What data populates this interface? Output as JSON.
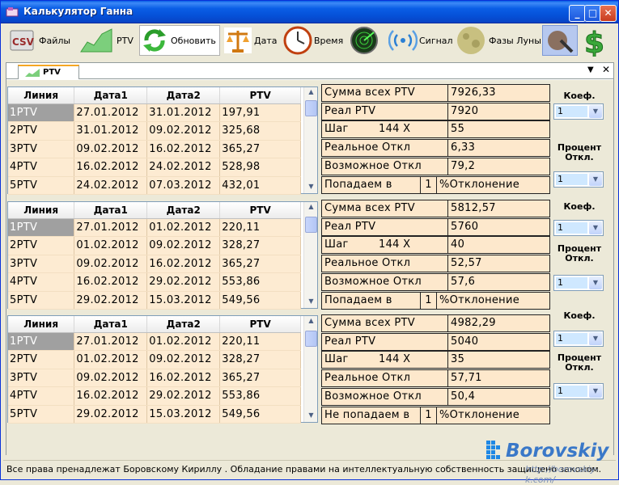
{
  "window": {
    "title": "Калькулятор Ганна"
  },
  "toolbar": {
    "files": "Файлы",
    "ptv": "PTV",
    "refresh": "Обновить",
    "date": "Дата",
    "time": "Время",
    "signal": "Сигнал",
    "moon": "Фазы Луны",
    "csv_text": "CSV",
    "dollar_text": "$"
  },
  "tab": {
    "label": "PTV"
  },
  "columns": [
    "Линия",
    "Дата1",
    "Дата2",
    "PTV"
  ],
  "grids": [
    {
      "rows": [
        [
          "1PTV",
          "27.01.2012",
          "31.01.2012",
          "197,91"
        ],
        [
          "2PTV",
          "31.01.2012",
          "09.02.2012",
          "325,68"
        ],
        [
          "3PTV",
          "09.02.2012",
          "16.02.2012",
          "365,27"
        ],
        [
          "4PTV",
          "16.02.2012",
          "24.02.2012",
          "528,98"
        ],
        [
          "5PTV",
          "24.02.2012",
          "07.03.2012",
          "432,01"
        ]
      ]
    },
    {
      "rows": [
        [
          "1PTV",
          "27.01.2012",
          "01.02.2012",
          "220,11"
        ],
        [
          "2PTV",
          "01.02.2012",
          "09.02.2012",
          "328,27"
        ],
        [
          "3PTV",
          "09.02.2012",
          "16.02.2012",
          "365,27"
        ],
        [
          "4PTV",
          "16.02.2012",
          "29.02.2012",
          "553,86"
        ],
        [
          "5PTV",
          "29.02.2012",
          "15.03.2012",
          "549,56"
        ]
      ]
    },
    {
      "rows": [
        [
          "1PTV",
          "27.01.2012",
          "01.02.2012",
          "220,11"
        ],
        [
          "2PTV",
          "01.02.2012",
          "09.02.2012",
          "328,27"
        ],
        [
          "3PTV",
          "09.02.2012",
          "16.02.2012",
          "365,27"
        ],
        [
          "4PTV",
          "16.02.2012",
          "29.02.2012",
          "553,86"
        ],
        [
          "5PTV",
          "29.02.2012",
          "15.03.2012",
          "549,56"
        ]
      ]
    }
  ],
  "info_labels": {
    "sum": "Сумма всех PTV",
    "real_ptv": "Реал PTV",
    "step": "Шаг",
    "step_mult": "144 X",
    "real_dev": "Реальное Откл",
    "possible_dev": "Возможное Откл",
    "pct_dev": "%Отклонение"
  },
  "info": [
    {
      "sum": "7926,33",
      "real_ptv": "7920",
      "step": "55",
      "real_dev": "6,33",
      "possible_dev": "79,2",
      "hit": "Попадаем в",
      "hit_val": "1"
    },
    {
      "sum": "5812,57",
      "real_ptv": "5760",
      "step": "40",
      "real_dev": "52,57",
      "possible_dev": "57,6",
      "hit": "Попадаем в",
      "hit_val": "1"
    },
    {
      "sum": "4982,29",
      "real_ptv": "5040",
      "step": "35",
      "real_dev": "57,71",
      "possible_dev": "50,4",
      "hit": "Не попадаем в",
      "hit_val": "1"
    }
  ],
  "controls": {
    "coef_label": "Коеф.",
    "pct_label_1": "Процент",
    "pct_label_2": "Откл.",
    "panels": [
      {
        "coef": "1",
        "pct": "1"
      },
      {
        "coef": "1",
        "pct": "1"
      },
      {
        "coef": "1",
        "pct": "1"
      }
    ]
  },
  "status": {
    "text": "Все права пренадлежат Боровскому Кириллу . Обладание правами на интеллектуальную собственность защищено законом."
  },
  "watermark": {
    "brand": "Borovskiy",
    "url": "http://borovskiy-k.com/"
  },
  "colors": {
    "titlebar": "#0a5ee6",
    "cell_bg": "#fdebd2",
    "info_bg": "#fde8cc",
    "selected": "#a0a0a0"
  }
}
